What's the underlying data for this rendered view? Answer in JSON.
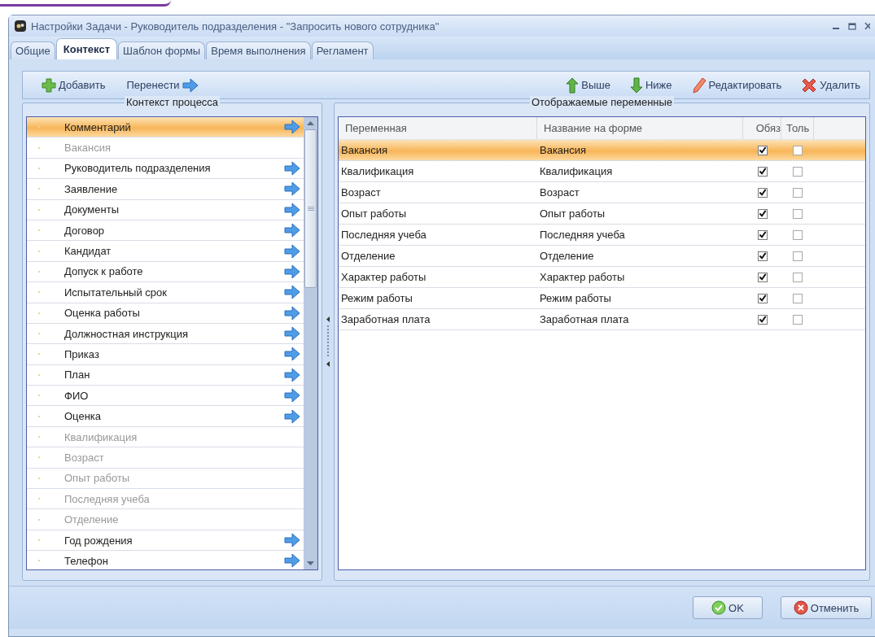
{
  "window": {
    "title": "Настройки Задачи - Руководитель подразделения - \"Запросить нового сотрудника\""
  },
  "tabs": [
    {
      "label": "Общие",
      "selected": false
    },
    {
      "label": "Контекст",
      "selected": true
    },
    {
      "label": "Шаблон формы",
      "selected": false
    },
    {
      "label": "Время выполнения",
      "selected": false
    },
    {
      "label": "Регламент",
      "selected": false
    }
  ],
  "toolbar": {
    "left": [
      {
        "label": "Добавить",
        "kind": "add"
      },
      {
        "label": "Перенести",
        "kind": "move"
      }
    ],
    "right": [
      {
        "label": "Выше",
        "kind": "up"
      },
      {
        "label": "Ниже",
        "kind": "down"
      },
      {
        "label": "Редактировать",
        "kind": "edit"
      },
      {
        "label": "Удалить",
        "kind": "delete"
      }
    ]
  },
  "context_panel": {
    "title": "Контекст процесса",
    "items": [
      {
        "label": "Комментарий",
        "selected": true,
        "disabled": false
      },
      {
        "label": "Вакансия",
        "selected": false,
        "disabled": true
      },
      {
        "label": "Руководитель подразделения",
        "selected": false,
        "disabled": false
      },
      {
        "label": "Заявление",
        "selected": false,
        "disabled": false
      },
      {
        "label": "Документы",
        "selected": false,
        "disabled": false
      },
      {
        "label": "Договор",
        "selected": false,
        "disabled": false
      },
      {
        "label": "Кандидат",
        "selected": false,
        "disabled": false
      },
      {
        "label": "Допуск к работе",
        "selected": false,
        "disabled": false
      },
      {
        "label": "Испытательный срок",
        "selected": false,
        "disabled": false
      },
      {
        "label": "Оценка работы",
        "selected": false,
        "disabled": false
      },
      {
        "label": "Должностная инструкция",
        "selected": false,
        "disabled": false
      },
      {
        "label": "Приказ",
        "selected": false,
        "disabled": false
      },
      {
        "label": "План",
        "selected": false,
        "disabled": false
      },
      {
        "label": "ФИО",
        "selected": false,
        "disabled": false
      },
      {
        "label": "Оценка",
        "selected": false,
        "disabled": false
      },
      {
        "label": "Квалификация",
        "selected": false,
        "disabled": true
      },
      {
        "label": "Возраст",
        "selected": false,
        "disabled": true
      },
      {
        "label": "Опыт работы",
        "selected": false,
        "disabled": true
      },
      {
        "label": "Последняя учеба",
        "selected": false,
        "disabled": true
      },
      {
        "label": "Отделение",
        "selected": false,
        "disabled": true
      },
      {
        "label": "Год рождения",
        "selected": false,
        "disabled": false
      },
      {
        "label": "Телефон",
        "selected": false,
        "disabled": false
      }
    ]
  },
  "variables_panel": {
    "title": "Отображаемые переменные",
    "columns": [
      "Переменная",
      "Название на форме",
      "Обяз",
      "Толь"
    ],
    "rows": [
      {
        "variable": "Вакансия",
        "form_name": "Вакансия",
        "required": true,
        "readonly": false,
        "selected": true
      },
      {
        "variable": "Квалификация",
        "form_name": "Квалификация",
        "required": true,
        "readonly": false,
        "selected": false
      },
      {
        "variable": "Возраст",
        "form_name": "Возраст",
        "required": true,
        "readonly": false,
        "selected": false
      },
      {
        "variable": "Опыт работы",
        "form_name": "Опыт работы",
        "required": true,
        "readonly": false,
        "selected": false
      },
      {
        "variable": "Последняя учеба",
        "form_name": "Последняя учеба",
        "required": true,
        "readonly": false,
        "selected": false
      },
      {
        "variable": "Отделение",
        "form_name": "Отделение",
        "required": true,
        "readonly": false,
        "selected": false
      },
      {
        "variable": "Характер работы",
        "form_name": "Характер работы",
        "required": true,
        "readonly": false,
        "selected": false
      },
      {
        "variable": "Режим работы",
        "form_name": "Режим работы",
        "required": true,
        "readonly": false,
        "selected": false
      },
      {
        "variable": "Заработная плата",
        "form_name": "Заработная плата",
        "required": true,
        "readonly": false,
        "selected": false
      }
    ]
  },
  "buttons": [
    {
      "label": "OK",
      "kind": "ok"
    },
    {
      "label": "Отменить",
      "kind": "cancel"
    }
  ]
}
